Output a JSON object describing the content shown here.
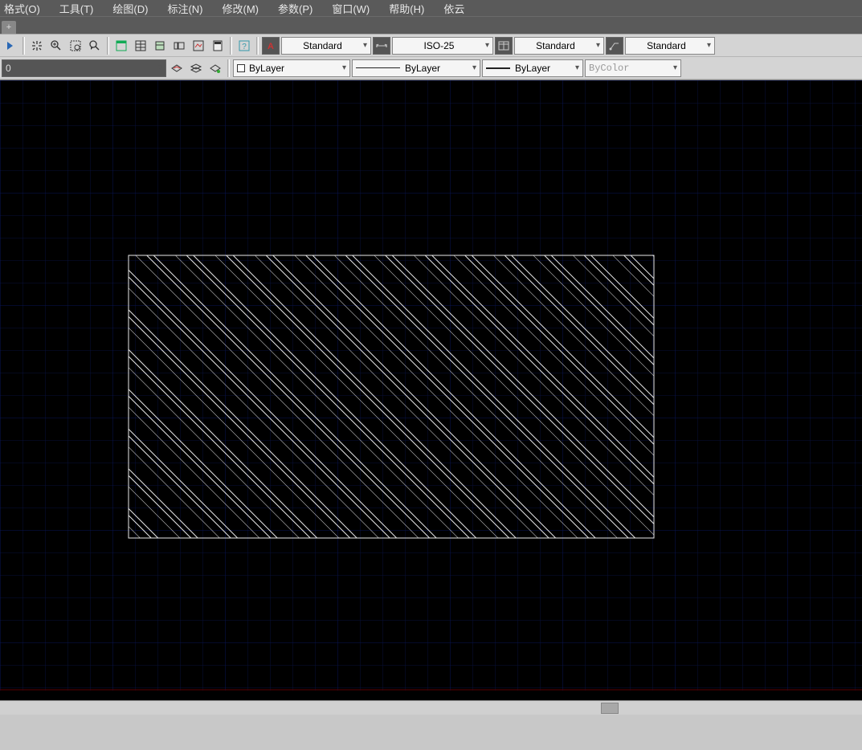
{
  "menu": {
    "format": "格式(O)",
    "tools": "工具(T)",
    "draw": "绘图(D)",
    "dim": "标注(N)",
    "modify": "修改(M)",
    "param": "参数(P)",
    "window": "窗口(W)",
    "help": "帮助(H)",
    "kayun": "依云"
  },
  "tabbar": {
    "plus": "+"
  },
  "toolbar1": {
    "textStyle": "Standard",
    "dimStyle": "ISO-25",
    "tableStyle": "Standard",
    "mleaderStyle": "Standard"
  },
  "toolbar2": {
    "layerPrefix": "0",
    "colorLabel": "ByLayer",
    "linetypeLabel": "ByLayer",
    "lineweightLabel": "ByLayer",
    "plotstyleLabel": "ByColor"
  },
  "hscroll": {
    "thumbLeft": 748,
    "thumbWidth": 22
  }
}
